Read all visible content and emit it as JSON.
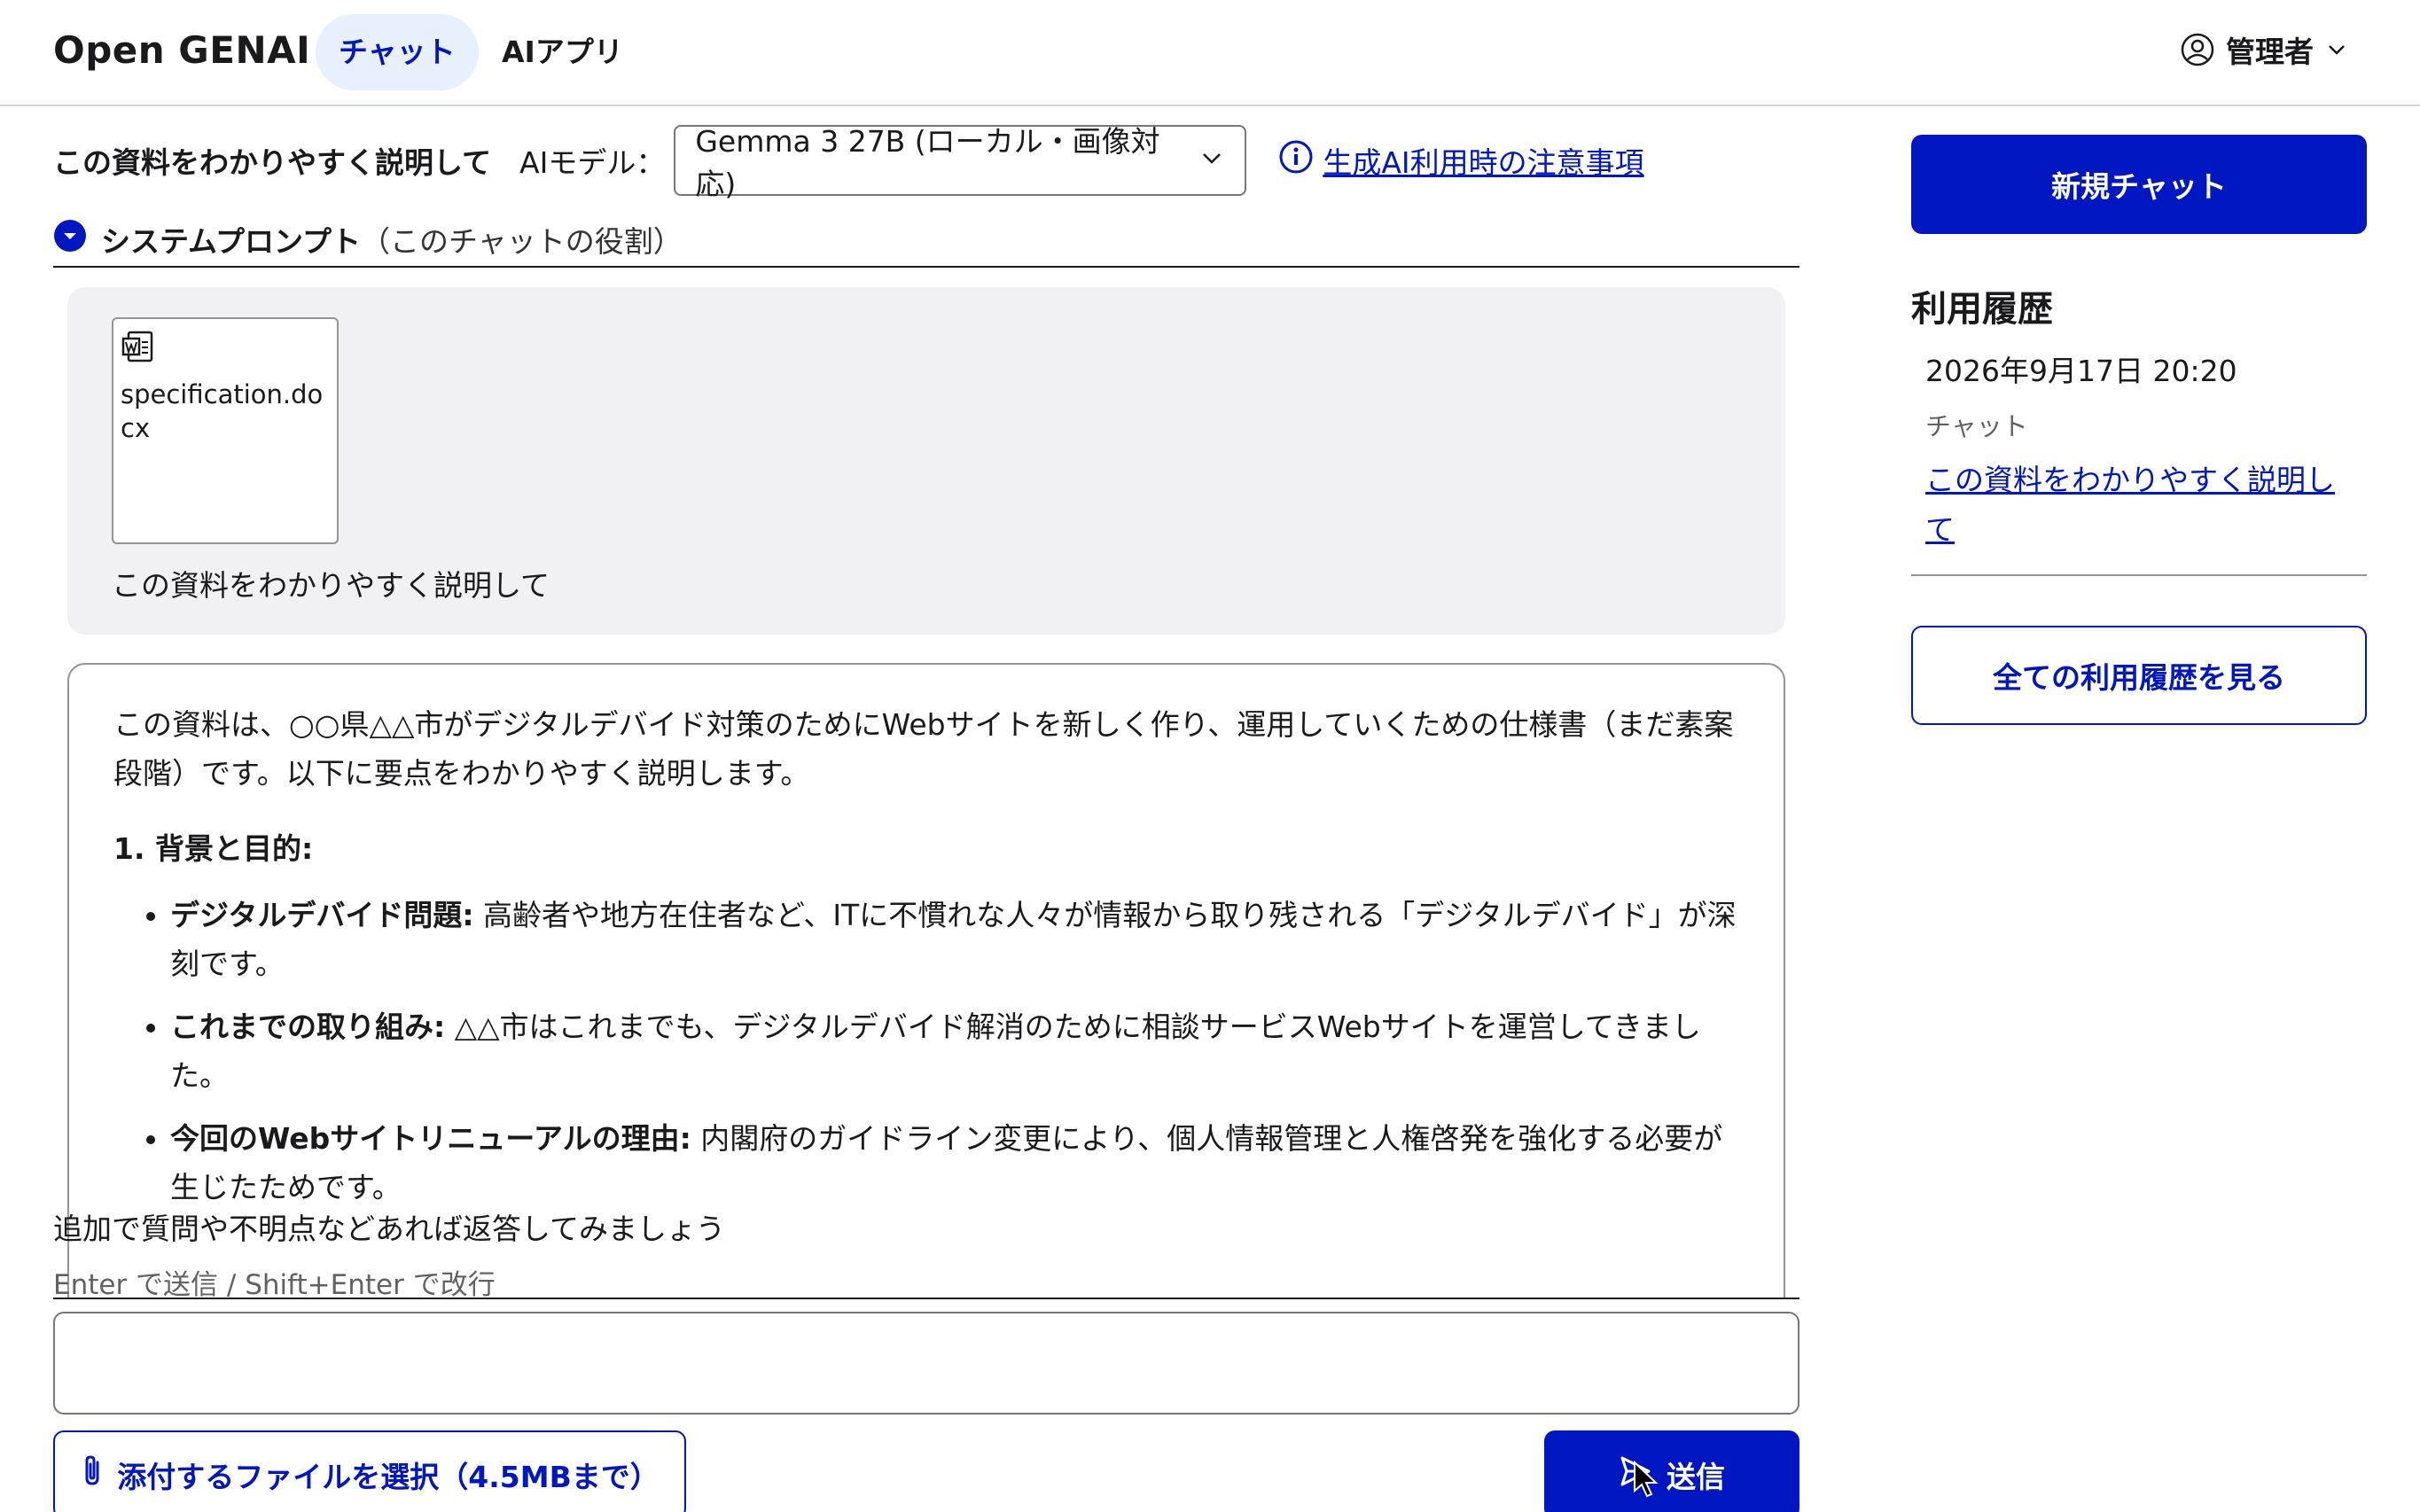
{
  "header": {
    "logo": "Open GENAI",
    "tabs": [
      {
        "label": "チャット",
        "active": true
      },
      {
        "label": "AIアプリ",
        "active": false
      }
    ],
    "user_label": "管理者"
  },
  "toolbar": {
    "title": "この資料をわかりやすく説明して",
    "model_label": "AIモデル：",
    "model_value": "Gemma 3 27B (ローカル・画像対応)",
    "notice_link": "生成AI利用時の注意事項"
  },
  "system_prompt": {
    "label": "システムプロンプト",
    "sub": "（このチャットの役割）"
  },
  "user_message": {
    "file_name": "specification.docx",
    "text": "この資料をわかりやすく説明して"
  },
  "ai_message": {
    "intro": "この資料は、○○県△△市がデジタルデバイド対策のためにWebサイトを新しく作り、運用していくための仕様書（まだ素案段階）です。以下に要点をわかりやすく説明します。",
    "heading": "1. 背景と目的:",
    "bullets": [
      {
        "bold": "デジタルデバイド問題:",
        "text": " 高齢者や地方在住者など、ITに不慣れな人々が情報から取り残される「デジタルデバイド」が深刻です。"
      },
      {
        "bold": "これまでの取り組み:",
        "text": " △△市はこれまでも、デジタルデバイド解消のために相談サービスWebサイトを運営してきました。"
      },
      {
        "bold": "今回のWebサイトリニューアルの理由:",
        "text": " 内閣府のガイドライン変更により、個人情報管理と人権啓発を強化する必要が生じたためです。"
      }
    ]
  },
  "input": {
    "hint": "追加で質問や不明点などあれば返答してみましょう",
    "shortcut": "Enter で送信 / Shift+Enter で改行",
    "value": "",
    "attach_label": "添付するファイルを選択（4.5MBまで）",
    "send_label": "送信"
  },
  "sidebar": {
    "new_chat": "新規チャット",
    "history_title": "利用履歴",
    "history_items": [
      {
        "date": "2026年9月17日 20:20",
        "type": "チャット",
        "title": "この資料をわかりやすく説明して"
      }
    ],
    "all_history": "全ての利用履歴を見る"
  },
  "colors": {
    "accent": "#0017c1",
    "active_tab_bg": "#e8f0fe",
    "user_bubble_bg": "#f1f1f4"
  }
}
